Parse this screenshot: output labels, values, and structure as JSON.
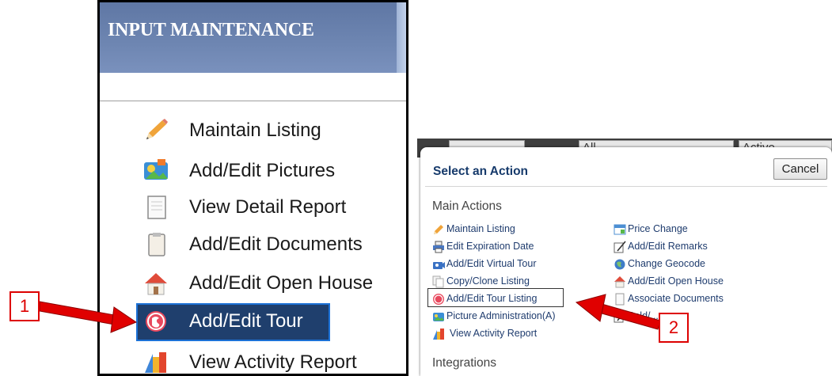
{
  "left_panel": {
    "title": "INPUT MAINTENANCE",
    "items": [
      {
        "label": "Maintain Listing",
        "icon": "pencil-icon"
      },
      {
        "label": "Add/Edit Pictures",
        "icon": "pictures-icon"
      },
      {
        "label": "View Detail Report",
        "icon": "document-icon"
      },
      {
        "label": "Add/Edit Documents",
        "icon": "clipboard-icon"
      },
      {
        "label": "Add/Edit Open House",
        "icon": "house-icon"
      },
      {
        "label": "Add/Edit Tour",
        "icon": "tour-icon"
      },
      {
        "label": "View Activity Report",
        "icon": "bar-chart-icon"
      }
    ]
  },
  "background_row": {
    "cells": [
      "",
      "All",
      "Active"
    ]
  },
  "dialog": {
    "title": "Select an Action",
    "cancel_label": "Cancel",
    "main_actions_heading": "Main Actions",
    "integrations_heading": "Integrations",
    "left_column": [
      {
        "label": "Maintain Listing",
        "icon": "pencil-icon"
      },
      {
        "label": "Edit Expiration Date",
        "icon": "printer-icon"
      },
      {
        "label": "Add/Edit Virtual Tour",
        "icon": "virtual-tour-icon"
      },
      {
        "label": "Copy/Clone Listing",
        "icon": "copy-icon"
      },
      {
        "label": "Add/Edit Tour Listing",
        "icon": "tour-icon"
      },
      {
        "label": "Picture Administration(A)",
        "icon": "pictures-icon"
      },
      {
        "label": "View Activity Report",
        "icon": "bar-chart-icon"
      }
    ],
    "right_column": [
      {
        "label": "Price Change",
        "icon": "price-tag-icon"
      },
      {
        "label": "Add/Edit Remarks",
        "icon": "edit-note-icon"
      },
      {
        "label": "Change Geocode",
        "icon": "globe-icon"
      },
      {
        "label": "Add/Edit Open House",
        "icon": "house-icon"
      },
      {
        "label": "Associate Documents",
        "icon": "document-icon"
      },
      {
        "label": "Sold/...",
        "icon": "edit-note-icon"
      }
    ]
  },
  "annotations": {
    "callout_1": "1",
    "callout_2": "2"
  },
  "colors": {
    "header_blue": "#6e86b2",
    "selected_bg": "#1f3f6d",
    "selected_border": "#1c71d6",
    "link_text": "#1f3c6e",
    "annotation_red": "#e00000"
  }
}
